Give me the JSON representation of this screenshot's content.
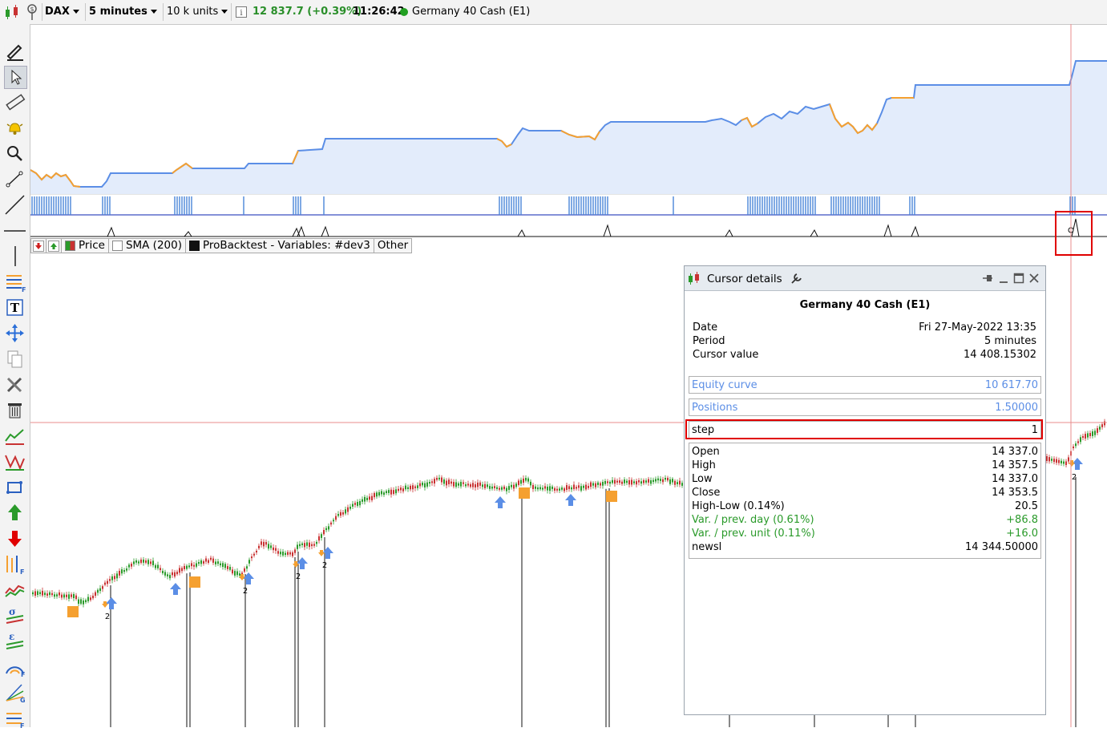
{
  "toolbar": {
    "instrument": "DAX",
    "period": "5 minutes",
    "units": "10 k units",
    "price_change": "12 837.7 (+0.39%)",
    "time": "11:26:42",
    "status_color": "#22a022",
    "instrument_name": "Germany 40 Cash (E1)"
  },
  "legend": {
    "price": "Price",
    "sma": "SMA (200)",
    "probacktest": "ProBacktest - Variables: #dev3",
    "other": "Other"
  },
  "colors": {
    "equity_line": "#5b8ee6",
    "equity_drawdown": "#f5a030",
    "equity_fill": "#e3ecfb",
    "positions_bar": "#4a86d8",
    "candle_up": "#2a9a2a",
    "candle_down": "#c83232",
    "buy_arrow": "#5b8ee6",
    "sell_marker": "#f5a030",
    "highlight": "#e00000"
  },
  "cursor_details": {
    "title": "Cursor details",
    "instrument": "Germany 40 Cash (E1)",
    "date_label": "Date",
    "date_value": "Fri 27-May-2022 13:35",
    "period_label": "Period",
    "period_value": "5 minutes",
    "cursor_label": "Cursor value",
    "cursor_value": "14 408.15302",
    "equity_label": "Equity curve",
    "equity_value": "10 617.70",
    "positions_label": "Positions",
    "positions_value": "1.50000",
    "step_label": "step",
    "step_value": "1",
    "open_label": "Open",
    "open_value": "14 337.0",
    "high_label": "High",
    "high_value": "14 357.5",
    "low_label": "Low",
    "low_value": "14 337.0",
    "close_label": "Close",
    "close_value": "14 353.5",
    "hl_label": "High-Low (0.14%)",
    "hl_value": "20.5",
    "var_day_label": "Var. / prev. day (0.61%)",
    "var_day_value": "+86.8",
    "var_unit_label": "Var. / prev. unit (0.11%)",
    "var_unit_value": "+16.0",
    "newsl_label": "newsl",
    "newsl_value": "14 344.50000"
  },
  "signal_labels": [
    "2",
    "2",
    "2",
    "2",
    "2"
  ]
}
